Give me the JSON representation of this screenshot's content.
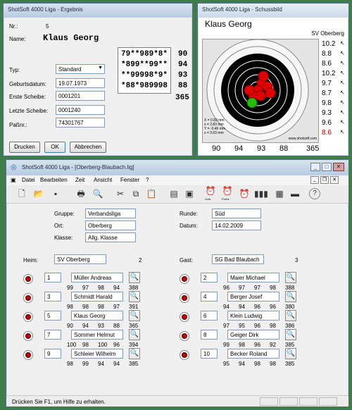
{
  "ergebnis": {
    "title": "ShotSoft 4000 Liga - Ergebnis",
    "nr_label": "Nr.:",
    "nr_value": "5",
    "name_label": "Name:",
    "name_value": "Klaus Georg",
    "typ_label": "Typ:",
    "typ_value": "Standard",
    "geb_label": "Geburtsdatum:",
    "geb_value": "19.07.1973",
    "erste_label": "Erste Scheibe:",
    "erste_value": "0001201",
    "letzte_label": "Letzte Scheibe:",
    "letzte_value": "0001240",
    "pass_label": "Paßnr.:",
    "pass_value": "74301767",
    "series": [
      {
        "shots": "79**989*8*",
        "score": "90"
      },
      {
        "shots": "*899**99**",
        "score": "94"
      },
      {
        "shots": "**99998*9*",
        "score": "93"
      },
      {
        "shots": "*88*989998",
        "score": "88"
      }
    ],
    "total": "365",
    "btn_print": "Drucken",
    "btn_ok": "OK",
    "btn_cancel": "Abbrechen"
  },
  "schussbild": {
    "title": "ShotSoft 4000 Liga - Schussbild",
    "name": "Klaus Georg",
    "club": "SV Oberberg",
    "shot_scores": [
      "10.2",
      "8.8",
      "8.6",
      "10.2",
      "9.7",
      "8.7",
      "9.8",
      "9.3",
      "9.6",
      "8.6"
    ],
    "stats": [
      "X = 0.83 mm",
      "s = 2.83 mm",
      "Y = -0.46 mm",
      "s = 3.63 mm"
    ],
    "website": "www.shotsoft.com",
    "series_scores": [
      "90",
      "94",
      "93",
      "88",
      "365"
    ]
  },
  "main": {
    "title": "ShotSoft 4000 Liga - [Oberberg-Blaubach.lig]",
    "menu": [
      "Datei",
      "Bearbeiten",
      "Zeit",
      "Ansicht",
      "Fenster",
      "?"
    ],
    "toolbar_labels": {
      "vorb": "Vorb.",
      "probe": "Probe"
    },
    "gruppe_label": "Gruppe:",
    "gruppe_value": "Verbandsliga",
    "ort_label": "Ort:",
    "ort_value": "Oberberg",
    "klasse_label": "Klasse:",
    "klasse_value": "Allg. Klasse",
    "runde_label": "Runde:",
    "runde_value": "Süd",
    "datum_label": "Datum:",
    "datum_value": "14.02.2009",
    "heim_label": "Heim:",
    "heim_value": "SV Oberberg",
    "heim_points": "2",
    "gast_label": "Gast:",
    "gast_value": "SG Bad Blaubach",
    "gast_points": "3",
    "home_shooters": [
      {
        "nr": "1",
        "name": "Müller Andreas",
        "series": [
          "99",
          "97",
          "98",
          "94"
        ],
        "total": "388"
      },
      {
        "nr": "3",
        "name": "Schmidt Harald",
        "series": [
          "98",
          "98",
          "98",
          "97"
        ],
        "total": "391"
      },
      {
        "nr": "5",
        "name": "Klaus Georg",
        "series": [
          "90",
          "94",
          "93",
          "88"
        ],
        "total": "365"
      },
      {
        "nr": "7",
        "name": "Sommer Helmut",
        "series": [
          "100",
          "98",
          "100",
          "96"
        ],
        "total": "394"
      },
      {
        "nr": "9",
        "name": "Schleier Wilhelm",
        "series": [
          "98",
          "99",
          "94",
          "94"
        ],
        "total": "385"
      }
    ],
    "guest_shooters": [
      {
        "nr": "2",
        "name": "Maier Michael",
        "series": [
          "96",
          "97",
          "97",
          "98"
        ],
        "total": "388"
      },
      {
        "nr": "4",
        "name": "Berger Josef",
        "series": [
          "94",
          "94",
          "96",
          "96"
        ],
        "total": "380"
      },
      {
        "nr": "6",
        "name": "Klein Ludwig",
        "series": [
          "97",
          "95",
          "96",
          "98"
        ],
        "total": "386"
      },
      {
        "nr": "8",
        "name": "Geiger Dirk",
        "series": [
          "99",
          "98",
          "96",
          "92"
        ],
        "total": "385"
      },
      {
        "nr": "10",
        "name": "Becker Roland",
        "series": [
          "95",
          "94",
          "98",
          "98"
        ],
        "total": "385"
      }
    ],
    "status": "Drücken Sie F1, um Hilfe zu erhalten."
  }
}
